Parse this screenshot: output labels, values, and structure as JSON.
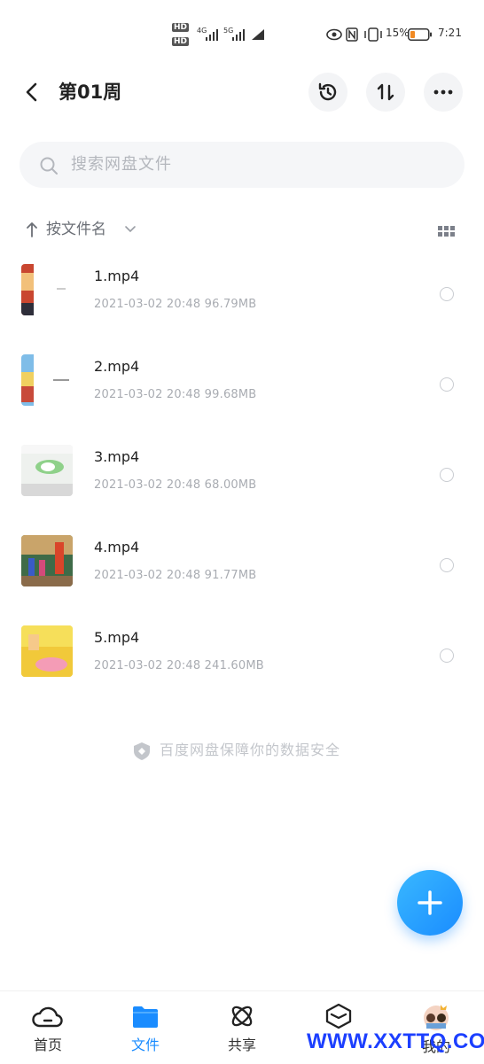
{
  "status_bar": {
    "network_a": "4G",
    "network_b": "5G",
    "battery_pct": "15%",
    "time": "7:21",
    "hd_a": "HD",
    "hd_b": "HD"
  },
  "header": {
    "title": "第01周"
  },
  "search": {
    "placeholder": "搜索网盘文件"
  },
  "sort": {
    "label": "按文件名"
  },
  "files": [
    {
      "name": "1.mp4",
      "meta": "2021-03-02  20:48   96.79MB"
    },
    {
      "name": "2.mp4",
      "meta": "2021-03-02  20:48   99.68MB"
    },
    {
      "name": "3.mp4",
      "meta": "2021-03-02  20:48   68.00MB"
    },
    {
      "name": "4.mp4",
      "meta": "2021-03-02  20:48   91.77MB"
    },
    {
      "name": "5.mp4",
      "meta": "2021-03-02  20:48   241.60MB"
    }
  ],
  "footer_note": "百度网盘保障你的数据安全",
  "nav": {
    "home": "首页",
    "files": "文件",
    "share": "共享",
    "items": "",
    "mine": "我的"
  },
  "watermark": "WWW.XXTTQ.COM",
  "colors": {
    "accent": "#1a8cff",
    "watermark": "#1c3fff"
  }
}
